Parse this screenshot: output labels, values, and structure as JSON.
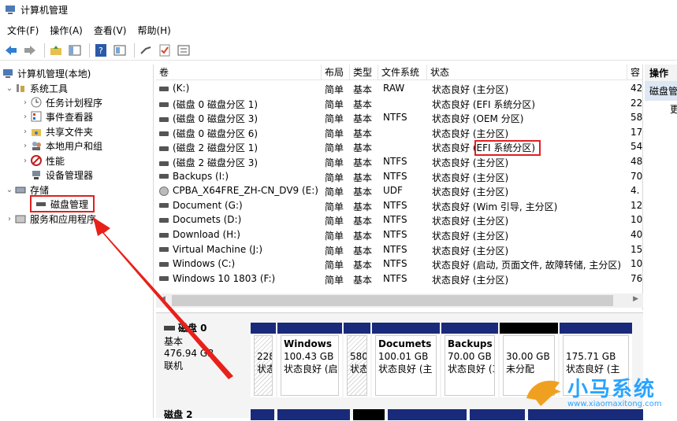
{
  "window": {
    "title": "计算机管理"
  },
  "menu": [
    "文件(F)",
    "操作(A)",
    "查看(V)",
    "帮助(H)"
  ],
  "tree": {
    "root": "计算机管理(本地)",
    "system_tools": "系统工具",
    "task_scheduler": "任务计划程序",
    "event_viewer": "事件查看器",
    "shared_folders": "共享文件夹",
    "local_users": "本地用户和组",
    "performance": "性能",
    "device_manager": "设备管理器",
    "storage": "存储",
    "disk_management": "磁盘管理",
    "services_apps": "服务和应用程序"
  },
  "columns": {
    "volume": "卷",
    "layout": "布局",
    "type": "类型",
    "fs": "文件系统",
    "status": "状态",
    "cap": "容"
  },
  "volumes": [
    {
      "name": "(K:)",
      "layout": "简单",
      "type": "基本",
      "fs": "RAW",
      "status": "状态良好 (主分区)",
      "cap": "42",
      "icon": "drive"
    },
    {
      "name": "(磁盘 0 磁盘分区 1)",
      "layout": "简单",
      "type": "基本",
      "fs": "",
      "status": "状态良好 (EFI 系统分区)",
      "cap": "22",
      "icon": "drive"
    },
    {
      "name": "(磁盘 0 磁盘分区 3)",
      "layout": "简单",
      "type": "基本",
      "fs": "NTFS",
      "status": "状态良好 (OEM 分区)",
      "cap": "58",
      "icon": "drive"
    },
    {
      "name": "(磁盘 0 磁盘分区 6)",
      "layout": "简单",
      "type": "基本",
      "fs": "",
      "status": "状态良好 (主分区)",
      "cap": "17",
      "icon": "drive"
    },
    {
      "name": "(磁盘 2 磁盘分区 1)",
      "layout": "简单",
      "type": "基本",
      "fs": "",
      "status": "状态良好 (EFI 系统分区)",
      "cap": "54",
      "icon": "drive"
    },
    {
      "name": "(磁盘 2 磁盘分区 3)",
      "layout": "简单",
      "type": "基本",
      "fs": "NTFS",
      "status": "状态良好 (主分区)",
      "cap": "48",
      "icon": "drive"
    },
    {
      "name": "Backups (I:)",
      "layout": "简单",
      "type": "基本",
      "fs": "NTFS",
      "status": "状态良好 (主分区)",
      "cap": "70",
      "icon": "drive"
    },
    {
      "name": "CPBA_X64FRE_ZH-CN_DV9 (E:)",
      "layout": "简单",
      "type": "基本",
      "fs": "UDF",
      "status": "状态良好 (主分区)",
      "cap": "4.",
      "icon": "cd"
    },
    {
      "name": "Document (G:)",
      "layout": "简单",
      "type": "基本",
      "fs": "NTFS",
      "status": "状态良好 (Wim 引导, 主分区)",
      "cap": "12",
      "icon": "drive"
    },
    {
      "name": "Documets (D:)",
      "layout": "简单",
      "type": "基本",
      "fs": "NTFS",
      "status": "状态良好 (主分区)",
      "cap": "10",
      "icon": "drive"
    },
    {
      "name": "Download (H:)",
      "layout": "简单",
      "type": "基本",
      "fs": "NTFS",
      "status": "状态良好 (主分区)",
      "cap": "40",
      "icon": "drive"
    },
    {
      "name": "Virtual Machine (J:)",
      "layout": "简单",
      "type": "基本",
      "fs": "NTFS",
      "status": "状态良好 (主分区)",
      "cap": "15",
      "icon": "drive"
    },
    {
      "name": "Windows (C:)",
      "layout": "简单",
      "type": "基本",
      "fs": "NTFS",
      "status": "状态良好 (启动, 页面文件, 故障转储, 主分区)",
      "cap": "10",
      "icon": "drive"
    },
    {
      "name": "Windows 10 1803 (F:)",
      "layout": "简单",
      "type": "基本",
      "fs": "NTFS",
      "status": "状态良好 (主分区)",
      "cap": "76",
      "icon": "drive"
    }
  ],
  "actions": {
    "header": "操作",
    "item1": "磁盘管",
    "item2": "更"
  },
  "disk0": {
    "name": "磁盘 0",
    "type": "基本",
    "size": "476.94 GB",
    "state": "联机"
  },
  "partitions": [
    {
      "name": "",
      "size": "228",
      "status": "状态",
      "band": "blue",
      "hatched": true
    },
    {
      "name": "Windows",
      "size": "100.43 GB",
      "status": "状态良好 (启",
      "band": "blue",
      "hatched": false
    },
    {
      "name": "",
      "size": "580 I",
      "status": "状态良",
      "band": "blue",
      "hatched": true
    },
    {
      "name": "Documets",
      "size": "100.01 GB",
      "status": "状态良好 (主",
      "band": "blue",
      "hatched": false
    },
    {
      "name": "Backups (",
      "size": "70.00 GB N",
      "status": "状态良好 (3",
      "band": "blue",
      "hatched": false
    },
    {
      "name": "",
      "size": "30.00 GB",
      "status": "未分配",
      "band": "black",
      "hatched": false
    },
    {
      "name": "",
      "size": "175.71 GB",
      "status": "状态良好 (主",
      "band": "blue",
      "hatched": false
    }
  ],
  "disk2": {
    "name": "磁盘 2"
  },
  "watermark": {
    "text": "小马系统",
    "url": "www.xiaomaxitong.com"
  }
}
